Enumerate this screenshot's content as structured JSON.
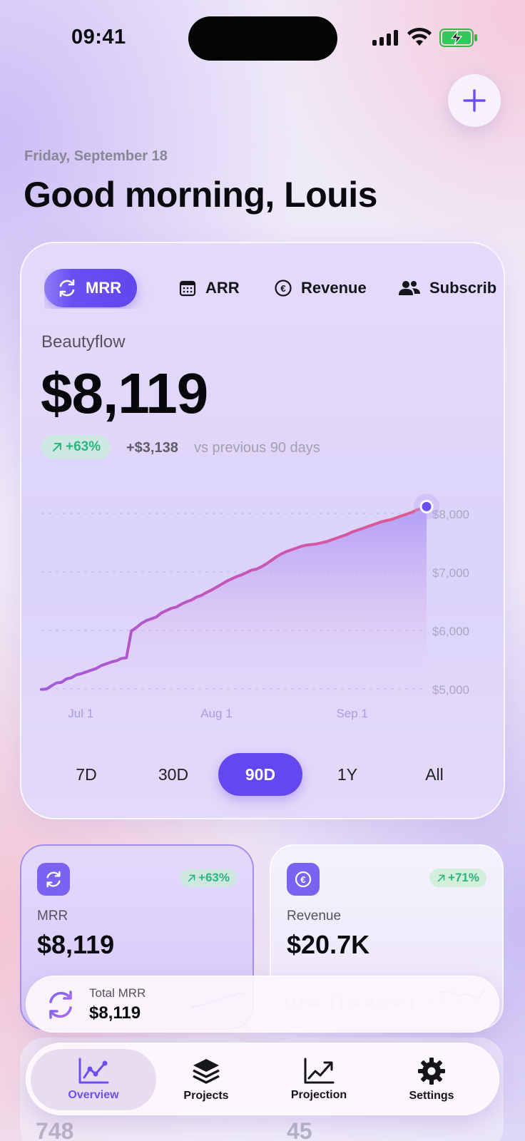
{
  "status_bar": {
    "time": "09:41"
  },
  "header": {
    "date": "Friday, September 18",
    "greeting": "Good morning, Louis"
  },
  "metric_tabs": [
    {
      "label": "MRR",
      "icon": "refresh-icon",
      "active": true
    },
    {
      "label": "ARR",
      "icon": "calendar-icon",
      "active": false
    },
    {
      "label": "Revenue",
      "icon": "euro-icon",
      "active": false
    },
    {
      "label": "Subscrib",
      "icon": "users-icon",
      "active": false
    }
  ],
  "summary": {
    "project": "Beautyflow",
    "value": "$8,119",
    "change_pct": "+63%",
    "change_abs": "+$3,138",
    "comparison": "vs previous 90 days"
  },
  "chart_data": {
    "type": "area",
    "x_ticks": [
      "Jul 1",
      "Aug 1",
      "Sep 1"
    ],
    "y_ticks": [
      "$5,000",
      "$6,000",
      "$7,000",
      "$8,000"
    ],
    "ylim": [
      4450,
      8600
    ],
    "x_start": "2020-06-22",
    "x_end": "2020-09-18",
    "series": [
      {
        "values": [
          4990,
          4995,
          5050,
          5100,
          5110,
          5170,
          5190,
          5240,
          5260,
          5290,
          5320,
          5350,
          5400,
          5430,
          5460,
          5480,
          5520,
          5530,
          5990,
          6050,
          6120,
          6170,
          6200,
          6230,
          6300,
          6340,
          6380,
          6400,
          6450,
          6490,
          6520,
          6570,
          6600,
          6650,
          6690,
          6740,
          6790,
          6840,
          6880,
          6920,
          6950,
          6990,
          7030,
          7050,
          7090,
          7140,
          7200,
          7260,
          7310,
          7350,
          7380,
          7410,
          7440,
          7460,
          7470,
          7480,
          7500,
          7520,
          7550,
          7580,
          7610,
          7640,
          7680,
          7710,
          7740,
          7770,
          7800,
          7830,
          7860,
          7880,
          7900,
          7930,
          7960,
          7990,
          8020,
          8060,
          8090,
          8119
        ]
      }
    ],
    "grid": true,
    "y_axis_position": "right"
  },
  "ranges": [
    {
      "label": "7D",
      "active": false
    },
    {
      "label": "30D",
      "active": false
    },
    {
      "label": "90D",
      "active": true
    },
    {
      "label": "1Y",
      "active": false
    },
    {
      "label": "All",
      "active": false
    }
  ],
  "cards": [
    {
      "label": "MRR",
      "value": "$8,119",
      "change": "+63%",
      "icon": "refresh-icon"
    },
    {
      "label": "Revenue",
      "value": "$20.7K",
      "change": "+71%",
      "icon": "euro-icon"
    }
  ],
  "cards_peek": [
    "748",
    "45"
  ],
  "total_pill": {
    "label": "Total MRR",
    "value": "$8,119"
  },
  "tabbar": [
    {
      "label": "Overview",
      "icon": "chart-line-icon",
      "active": true
    },
    {
      "label": "Projects",
      "icon": "layers-icon",
      "active": false
    },
    {
      "label": "Projection",
      "icon": "trend-up-icon",
      "active": false
    },
    {
      "label": "Settings",
      "icon": "gear-icon",
      "active": false
    }
  ],
  "colors": {
    "accent": "#6547ef",
    "positive": "#2db57e",
    "line_start": "#a25adf",
    "line_end": "#e25a8e"
  }
}
